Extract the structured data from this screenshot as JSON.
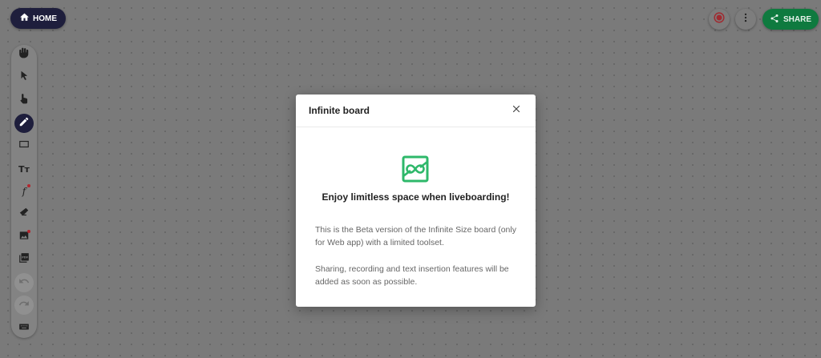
{
  "header": {
    "home_label": "HOME",
    "share_label": "SHARE"
  },
  "icons": {
    "home": "home-icon",
    "record": "record-icon",
    "more": "more-vertical-icon",
    "share": "share-icon"
  },
  "toolbar": {
    "tools": [
      {
        "name": "hand",
        "icon": "hand-icon"
      },
      {
        "name": "select",
        "icon": "cursor-arrow-icon"
      },
      {
        "name": "pointer",
        "icon": "pointing-hand-icon"
      },
      {
        "name": "pen",
        "icon": "pencil-icon",
        "active": true
      },
      {
        "name": "rectangle",
        "icon": "rectangle-icon"
      },
      {
        "name": "text",
        "icon": "text-size-icon",
        "label": "Tт"
      },
      {
        "name": "formula",
        "icon": "function-icon",
        "label": "f"
      },
      {
        "name": "eraser",
        "icon": "eraser-icon"
      },
      {
        "name": "image",
        "icon": "image-icon"
      },
      {
        "name": "pdf",
        "icon": "pdf-icon"
      },
      {
        "name": "undo",
        "icon": "undo-icon",
        "disabled": true
      },
      {
        "name": "redo",
        "icon": "redo-icon",
        "disabled": true
      },
      {
        "name": "keyboard",
        "icon": "keyboard-icon"
      }
    ]
  },
  "modal": {
    "title": "Infinite board",
    "heading": "Enjoy limitless space when liveboarding!",
    "paragraph1": "This is the Beta version of the Infinite Size board (only for Web app) with a limited toolset.",
    "paragraph2": "Sharing, recording and text insertion features will be added as soon as possible."
  },
  "colors": {
    "home_bg": "#1e1e3c",
    "share_bg": "#0f7a3f",
    "record_red": "#b3262e",
    "logo_green": "#2eb86a"
  }
}
